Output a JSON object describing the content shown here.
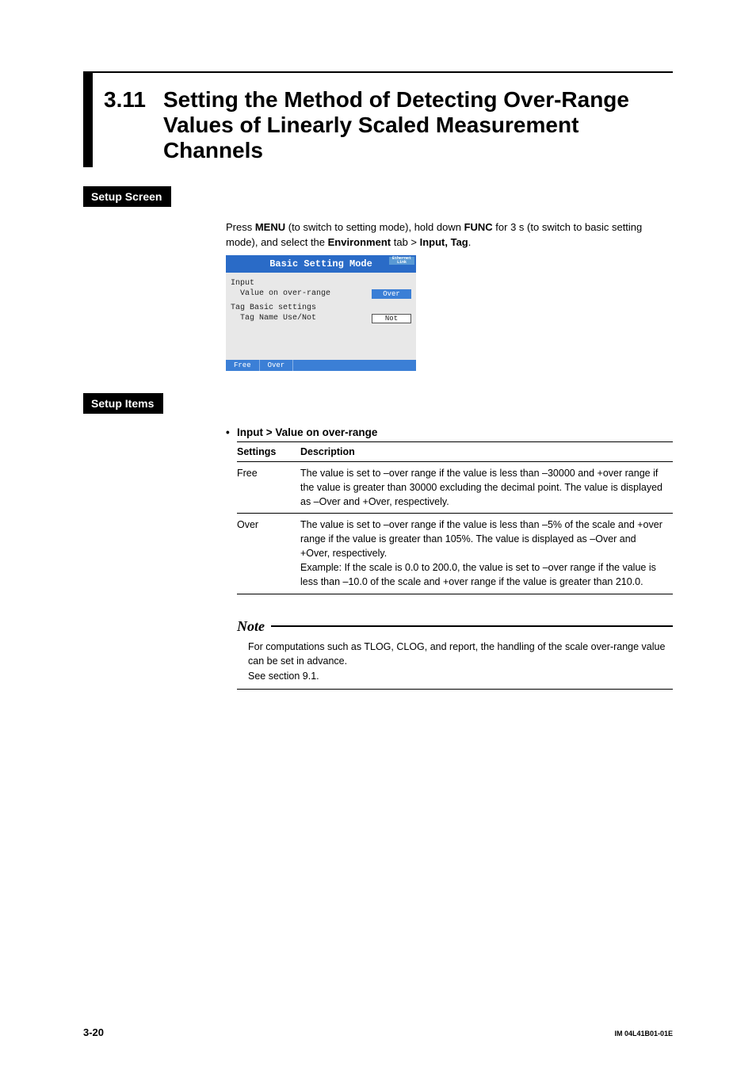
{
  "heading": {
    "number": "3.11",
    "title": "Setting the Method of Detecting Over-Range Values of Linearly Scaled Measurement Channels"
  },
  "setup_screen": {
    "label": "Setup Screen",
    "intro_pre": "Press ",
    "intro_menu": "MENU",
    "intro_mid1": " (to switch to setting mode), hold down ",
    "intro_func": "FUNC",
    "intro_mid2": " for 3 s (to switch to basic setting mode), and select the ",
    "intro_env": "Environment",
    "intro_mid3": " tab > ",
    "intro_inputtag": "Input, Tag",
    "intro_end": ".",
    "shot": {
      "title": "Basic Setting Mode",
      "badge": "Ethernet Link",
      "group1": "Input",
      "row1_label": "  Value on over-range",
      "row1_value": "Over",
      "group2": "Tag Basic settings",
      "row2_label": "  Tag Name Use/Not",
      "row2_value": "Not",
      "footer_btn1": "Free",
      "footer_btn2": "Over"
    }
  },
  "setup_items": {
    "label": "Setup Items",
    "item_title": "Input > Value on over-range",
    "th_settings": "Settings",
    "th_desc": "Description",
    "rows": [
      {
        "setting": "Free",
        "desc": "The value is set to –over range if the value is less than –30000 and +over range if the value is greater than 30000 excluding the decimal point. The value is displayed as –Over and +Over, respectively."
      },
      {
        "setting": "Over",
        "desc": "The value is set to –over range if the value is less than –5% of the scale and +over range if the value is greater than 105%. The value is displayed as –Over and +Over, respectively.\nExample:  If the scale is 0.0 to 200.0, the value is set to –over range if the value is less than –10.0 of the scale and +over range if the value is greater than 210.0."
      }
    ]
  },
  "note": {
    "word": "Note",
    "body1": "For computations such as TLOG, CLOG, and report, the handling of the scale over-range value can be set in advance.",
    "body2": "See section 9.1."
  },
  "footer": {
    "page": "3-20",
    "doc": "IM 04L41B01-01E"
  }
}
